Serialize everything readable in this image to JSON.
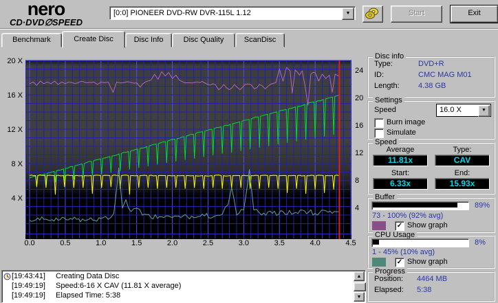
{
  "header": {
    "logo": {
      "top": "nero",
      "bottom_left": "CD·DVD",
      "disc": "∅",
      "bottom_right": "SPEED"
    },
    "drive_select": "[0:0]   PIONEER DVD-RW  DVR-115L 1.12",
    "start_label": "Start",
    "exit_label": "Exit"
  },
  "tabs": [
    {
      "label": "Benchmark",
      "active": false
    },
    {
      "label": "Create Disc",
      "active": true
    },
    {
      "label": "Disc Info",
      "active": false
    },
    {
      "label": "Disc Quality",
      "active": false
    },
    {
      "label": "ScanDisc",
      "active": false
    }
  ],
  "chart_data": {
    "type": "line",
    "x_range": [
      0,
      4.5
    ],
    "left_axis_range": [
      0,
      20
    ],
    "right_axis_range": [
      0,
      26
    ],
    "x_ticks": [
      "0.0",
      "0.5",
      "1.0",
      "1.5",
      "2.0",
      "2.5",
      "3.0",
      "3.5",
      "4.0",
      "4.5"
    ],
    "left_axis_ticks": [
      [
        20,
        "20 X"
      ],
      [
        16,
        "16 X"
      ],
      [
        12,
        "12 X"
      ],
      [
        8,
        "8 X"
      ],
      [
        4,
        "4 X"
      ]
    ],
    "right_axis_ticks": [
      [
        24,
        "24"
      ],
      [
        20,
        "20"
      ],
      [
        16,
        "16"
      ],
      [
        12,
        "12"
      ],
      [
        8,
        "8"
      ],
      [
        4,
        "4"
      ]
    ],
    "position_marker_gb": 4.34,
    "grid": true,
    "series": {
      "write_speed": {
        "name": "write-speed",
        "color": "#00dd33",
        "type": "ramp",
        "x_start": 0,
        "x_end": 4.33,
        "v_start": 6.33,
        "v_end": 15.93,
        "dips": [
          [
            0.1,
            1.1
          ],
          [
            0.23,
            1.2
          ],
          [
            0.36,
            1.3
          ],
          [
            0.49,
            1.4
          ],
          [
            0.62,
            1.5
          ],
          [
            0.75,
            1.6
          ],
          [
            0.88,
            1.7
          ],
          [
            1.01,
            1.8
          ],
          [
            1.14,
            1.9
          ],
          [
            1.27,
            2.0
          ],
          [
            1.4,
            2.1
          ],
          [
            1.53,
            2.2
          ],
          [
            1.66,
            2.3
          ],
          [
            1.79,
            2.4
          ],
          [
            1.92,
            2.5
          ],
          [
            2.05,
            2.6
          ],
          [
            2.18,
            2.7
          ],
          [
            2.31,
            2.85
          ],
          [
            2.44,
            2.95
          ],
          [
            2.57,
            3.05
          ],
          [
            2.7,
            3.15
          ],
          [
            2.83,
            3.3
          ],
          [
            2.96,
            3.4
          ],
          [
            3.09,
            3.5
          ],
          [
            3.22,
            3.6
          ],
          [
            3.35,
            3.7
          ],
          [
            3.48,
            3.8
          ],
          [
            3.61,
            3.9
          ],
          [
            3.74,
            4.0
          ],
          [
            3.87,
            4.1
          ],
          [
            4.0,
            4.2
          ],
          [
            4.13,
            4.3
          ],
          [
            4.26,
            4.4
          ]
        ]
      },
      "rotation_speed": {
        "name": "rotation-speed",
        "color": "#ffff00",
        "type": "flat",
        "x_start": 0,
        "x_end": 4.33,
        "level": 6.6,
        "dips": [
          [
            0.1,
            1.3
          ],
          [
            0.23,
            1.4
          ],
          [
            0.36,
            2.2
          ],
          [
            0.49,
            1.3
          ],
          [
            0.62,
            1.4
          ],
          [
            0.75,
            1.4
          ],
          [
            0.88,
            2.1
          ],
          [
            1.01,
            1.4
          ],
          [
            1.14,
            1.3
          ],
          [
            1.27,
            1.5
          ],
          [
            1.4,
            2.2
          ],
          [
            1.53,
            1.4
          ],
          [
            1.66,
            1.4
          ],
          [
            1.79,
            1.5
          ],
          [
            1.92,
            1.4
          ],
          [
            2.05,
            1.4
          ],
          [
            2.18,
            1.5
          ],
          [
            2.31,
            1.4
          ],
          [
            2.44,
            1.5
          ],
          [
            2.57,
            1.4
          ],
          [
            2.7,
            1.5
          ],
          [
            2.83,
            1.5
          ],
          [
            2.96,
            1.4
          ],
          [
            3.09,
            1.5
          ],
          [
            3.22,
            1.5
          ],
          [
            3.35,
            1.4
          ],
          [
            3.48,
            1.5
          ],
          [
            3.61,
            2.0
          ],
          [
            3.74,
            1.5
          ],
          [
            3.87,
            2.1
          ],
          [
            4.0,
            1.6
          ],
          [
            4.13,
            2.0
          ],
          [
            4.26,
            1.6
          ]
        ]
      },
      "buffer": {
        "name": "buffer-level",
        "color": "#b266b2",
        "type": "anchors",
        "jitter": 0.12,
        "points": [
          [
            0,
            17.3
          ],
          [
            0.05,
            17.5
          ],
          [
            0.1,
            17.1
          ],
          [
            0.15,
            17.6
          ],
          [
            0.2,
            17.3
          ],
          [
            0.25,
            17.5
          ],
          [
            0.3,
            17.3
          ],
          [
            0.35,
            17.6
          ],
          [
            0.4,
            17.2
          ],
          [
            0.45,
            17.5
          ],
          [
            0.5,
            17.3
          ],
          [
            0.55,
            17.5
          ],
          [
            0.6,
            17.4
          ],
          [
            0.7,
            17.5
          ],
          [
            0.8,
            17.4
          ],
          [
            0.9,
            17.5
          ],
          [
            0.95,
            17.2
          ],
          [
            1.0,
            17.5
          ],
          [
            1.05,
            17.4
          ],
          [
            1.1,
            17.5
          ],
          [
            1.17,
            16.3
          ],
          [
            1.22,
            17.5
          ],
          [
            1.3,
            17.4
          ],
          [
            1.4,
            17.5
          ],
          [
            1.5,
            17.4
          ],
          [
            1.55,
            16.9
          ],
          [
            1.62,
            17.5
          ],
          [
            1.7,
            17.7
          ],
          [
            1.75,
            18.4
          ],
          [
            1.8,
            17.8
          ],
          [
            1.85,
            18.7
          ],
          [
            1.9,
            18.2
          ],
          [
            1.95,
            18.6
          ],
          [
            2.0,
            17.9
          ],
          [
            2.05,
            18.3
          ],
          [
            2.1,
            17.7
          ],
          [
            2.15,
            17.5
          ],
          [
            2.25,
            17.4
          ],
          [
            2.35,
            17.5
          ],
          [
            2.45,
            17.4
          ],
          [
            2.5,
            17.2
          ],
          [
            2.6,
            17.2
          ],
          [
            2.65,
            16.6
          ],
          [
            2.72,
            17.2
          ],
          [
            2.8,
            16.6
          ],
          [
            2.87,
            17.2
          ],
          [
            2.95,
            16.6
          ],
          [
            3.02,
            17.2
          ],
          [
            3.1,
            17.2
          ],
          [
            3.15,
            16.7
          ],
          [
            3.22,
            17.2
          ],
          [
            3.3,
            16.7
          ],
          [
            3.37,
            17.2
          ],
          [
            3.45,
            17.4
          ],
          [
            3.5,
            19.0
          ],
          [
            3.55,
            17.6
          ],
          [
            3.6,
            19.2
          ],
          [
            3.65,
            18.8
          ],
          [
            3.68,
            16.2
          ],
          [
            3.72,
            18.9
          ],
          [
            3.78,
            18.3
          ],
          [
            3.82,
            18.8
          ],
          [
            3.86,
            17.0
          ],
          [
            3.9,
            14.8
          ],
          [
            3.94,
            18.4
          ],
          [
            4.0,
            18.6
          ],
          [
            4.05,
            17.6
          ],
          [
            4.1,
            18.4
          ],
          [
            4.15,
            17.9
          ],
          [
            4.2,
            18.3
          ],
          [
            4.24,
            16.3
          ],
          [
            4.28,
            18.4
          ],
          [
            4.33,
            18.2
          ]
        ]
      },
      "cpu": {
        "name": "cpu-usage",
        "color": "#63a197",
        "type": "anchors",
        "jitter": 0.32,
        "points": [
          [
            0,
            1.4
          ],
          [
            0.2,
            1.5
          ],
          [
            0.4,
            1.4
          ],
          [
            0.6,
            1.5
          ],
          [
            0.8,
            1.4
          ],
          [
            1.0,
            1.6
          ],
          [
            1.1,
            1.5
          ],
          [
            1.18,
            2.2
          ],
          [
            1.25,
            7.5
          ],
          [
            1.3,
            2.8
          ],
          [
            1.35,
            3.8
          ],
          [
            1.42,
            2.4
          ],
          [
            1.5,
            2.8
          ],
          [
            1.58,
            2.0
          ],
          [
            1.7,
            1.7
          ],
          [
            1.85,
            1.8
          ],
          [
            2.0,
            1.7
          ],
          [
            2.15,
            1.9
          ],
          [
            2.3,
            1.7
          ],
          [
            2.45,
            1.9
          ],
          [
            2.6,
            1.9
          ],
          [
            2.7,
            2.1
          ],
          [
            2.78,
            3.2
          ],
          [
            2.83,
            5.2
          ],
          [
            2.9,
            2.0
          ],
          [
            3.0,
            2.6
          ],
          [
            3.08,
            7.3
          ],
          [
            3.14,
            2.6
          ],
          [
            3.25,
            2.0
          ],
          [
            3.4,
            2.2
          ],
          [
            3.55,
            2.4
          ],
          [
            3.7,
            2.2
          ],
          [
            3.85,
            2.5
          ],
          [
            4.0,
            2.2
          ],
          [
            4.15,
            2.5
          ],
          [
            4.33,
            2.4
          ]
        ]
      }
    }
  },
  "panels": {
    "disc_info": {
      "title": "Disc info",
      "rows": [
        [
          "Type:",
          "DVD+R"
        ],
        [
          "ID:",
          "CMC MAG M01"
        ],
        [
          "Length:",
          "4.38 GB"
        ]
      ]
    },
    "settings": {
      "title": "Settings",
      "speed_label": "Speed",
      "speed_value": "16.0 X",
      "checkboxes": [
        {
          "label": "Burn image",
          "checked": false
        },
        {
          "label": "Simulate",
          "checked": false
        }
      ]
    },
    "speed": {
      "title": "Speed",
      "cells": [
        {
          "label": "Average",
          "value": "11.81x"
        },
        {
          "label": "Type:",
          "value": "CAV"
        },
        {
          "label": "Start:",
          "value": "6.33x"
        },
        {
          "label": "End:",
          "value": "15.93x"
        }
      ]
    },
    "buffer": {
      "title": "Buffer",
      "percent": 89,
      "percent_label": "89%",
      "range_label": "73 - 100% (92% avg)",
      "show_graph_label": "Show graph",
      "checked": true,
      "swatch_color": "#8a4f8a"
    },
    "cpu": {
      "title": "CPU Usage",
      "percent": 8,
      "percent_label": "8%",
      "range_label": "1 - 45% (10% avg)",
      "show_graph_label": "Show graph",
      "checked": true,
      "swatch_color": "#4d8878"
    },
    "progress": {
      "title": "Progress",
      "rows": [
        [
          "Position:",
          "4464 MB"
        ],
        [
          "Elapsed:",
          "5:38"
        ]
      ]
    }
  },
  "log": {
    "lines": [
      {
        "time": "[19:43:41]",
        "text": "Creating Data Disc",
        "icon": true
      },
      {
        "time": "[19:49:19]",
        "text": "Speed:6-16 X CAV (11.81 X average)",
        "icon": false
      },
      {
        "time": "[19:49:19]",
        "text": "Elapsed Time:  5:38",
        "icon": false
      }
    ]
  },
  "colors": {
    "window_bg": "#c0c0c0",
    "grid_minor": "#2222a8",
    "grid_major": "#4d4dff",
    "value_text": "#2a35a8",
    "lcd_text": "#00d8e8",
    "position_marker": "#e02020"
  }
}
